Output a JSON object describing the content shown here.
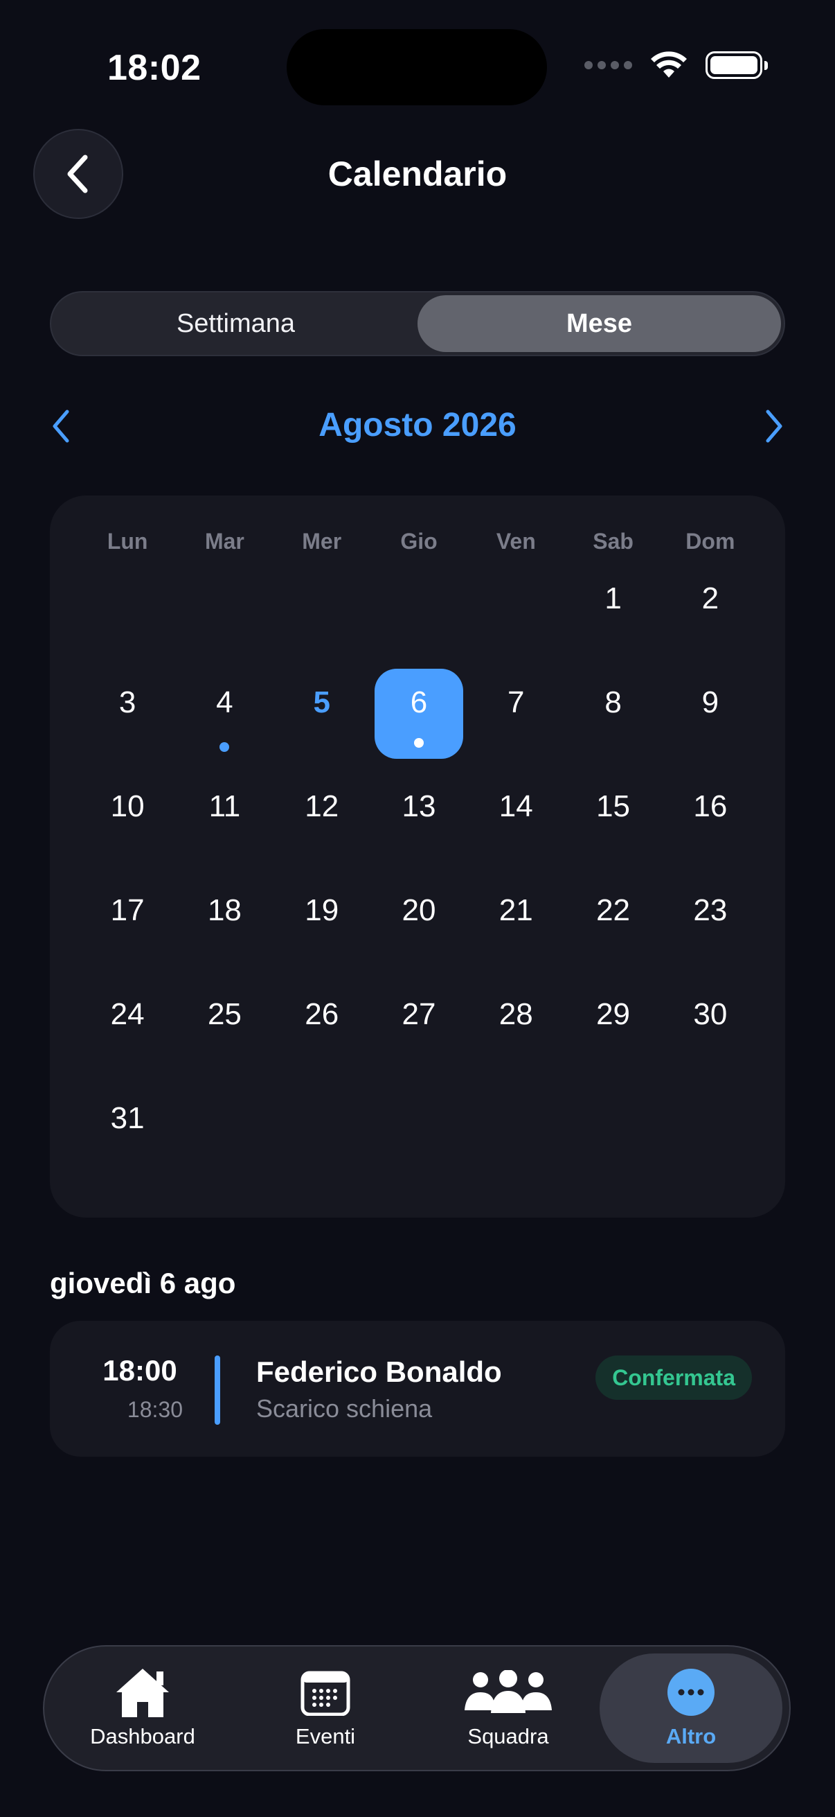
{
  "status_bar": {
    "time": "18:02"
  },
  "header": {
    "title": "Calendario"
  },
  "segmented": {
    "options": [
      "Settimana",
      "Mese"
    ],
    "selected": "Mese"
  },
  "month_nav": {
    "title": "Agosto 2026"
  },
  "calendar": {
    "weekdays": [
      "Lun",
      "Mar",
      "Mer",
      "Gio",
      "Ven",
      "Sab",
      "Dom"
    ],
    "leading_blanks": 5,
    "days": [
      "1",
      "2",
      "3",
      "4",
      "5",
      "6",
      "7",
      "8",
      "9",
      "10",
      "11",
      "12",
      "13",
      "14",
      "15",
      "16",
      "17",
      "18",
      "19",
      "20",
      "21",
      "22",
      "23",
      "24",
      "25",
      "26",
      "27",
      "28",
      "29",
      "30",
      "31"
    ],
    "today": "5",
    "selected": "6",
    "days_with_events": [
      "4",
      "6"
    ]
  },
  "events": {
    "date_heading": "giovedì 6 ago",
    "items": [
      {
        "start": "18:00",
        "end": "18:30",
        "name": "Federico Bonaldo",
        "subtitle": "Scarico schiena",
        "status": "Confermata"
      }
    ]
  },
  "tabbar": {
    "items": [
      {
        "label": "Dashboard",
        "icon": "home-icon"
      },
      {
        "label": "Eventi",
        "icon": "calendar-icon"
      },
      {
        "label": "Squadra",
        "icon": "people-icon"
      },
      {
        "label": "Altro",
        "icon": "more-icon"
      }
    ],
    "active": "Altro"
  },
  "colors": {
    "accent": "#4a9eff",
    "background": "#0c0d16",
    "card": "#161720",
    "confirmed": "#34c791"
  }
}
